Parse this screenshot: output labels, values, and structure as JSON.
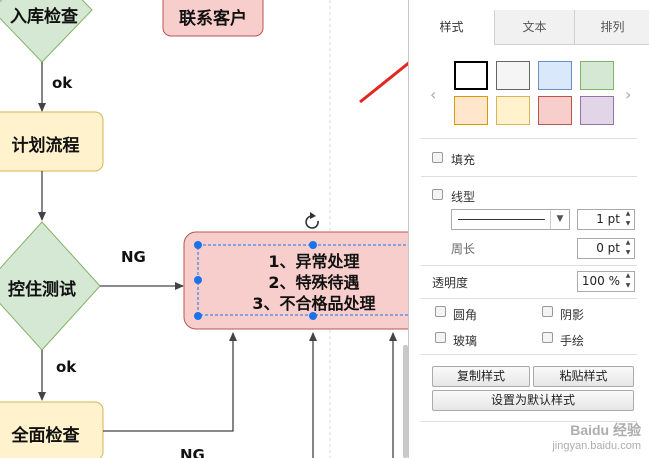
{
  "canvas": {
    "nodes": {
      "top_diamond": "入库检查",
      "top_rect": "联系客户",
      "plan": "计划流程",
      "control": "控住测试",
      "full_check": "全面检查",
      "selected": [
        "1、异常处理",
        "2、特殊待遇",
        "3、不合格品处理"
      ]
    },
    "edges": {
      "ok1": "ok",
      "ng1": "NG",
      "ok2": "ok",
      "ng2": "NG"
    },
    "colors": {
      "diamond_fill": "#d5e8d4",
      "diamond_stroke": "#82b366",
      "yellow_fill": "#fff2cc",
      "yellow_stroke": "#d6b656",
      "red_fill": "#f8cecc",
      "red_stroke": "#b85450",
      "selection": "#1a73e8",
      "annotation_arrow": "#e3261f"
    }
  },
  "panel": {
    "tabs": [
      {
        "label": "样式",
        "active": true
      },
      {
        "label": "文本",
        "active": false
      },
      {
        "label": "排列",
        "active": false
      }
    ],
    "swatches": [
      {
        "fill": "#ffffff",
        "stroke": "#000000"
      },
      {
        "fill": "#f5f5f5",
        "stroke": "#666666"
      },
      {
        "fill": "#dae8fc",
        "stroke": "#6c8ebf"
      },
      {
        "fill": "#d5e8d4",
        "stroke": "#82b366"
      },
      {
        "fill": "#ffe6cc",
        "stroke": "#d79b00"
      },
      {
        "fill": "#fff2cc",
        "stroke": "#d6b656"
      },
      {
        "fill": "#f8cecc",
        "stroke": "#b85450"
      },
      {
        "fill": "#e1d5e7",
        "stroke": "#9673a6"
      }
    ],
    "fill_label": "填充",
    "line_label": "线型",
    "line_width": "1 pt",
    "perimeter_label": "周长",
    "perimeter_value": "0 pt",
    "opacity_label": "透明度",
    "opacity_value": "100 %",
    "rounded_label": "圆角",
    "shadow_label": "阴影",
    "glass_label": "玻璃",
    "sketch_label": "手绘",
    "copy_style": "复制样式",
    "paste_style": "粘贴样式",
    "set_default": "设置为默认样式",
    "watermark_line1": "Baidu 经验",
    "watermark_line2": "jingyan.baidu.com"
  }
}
